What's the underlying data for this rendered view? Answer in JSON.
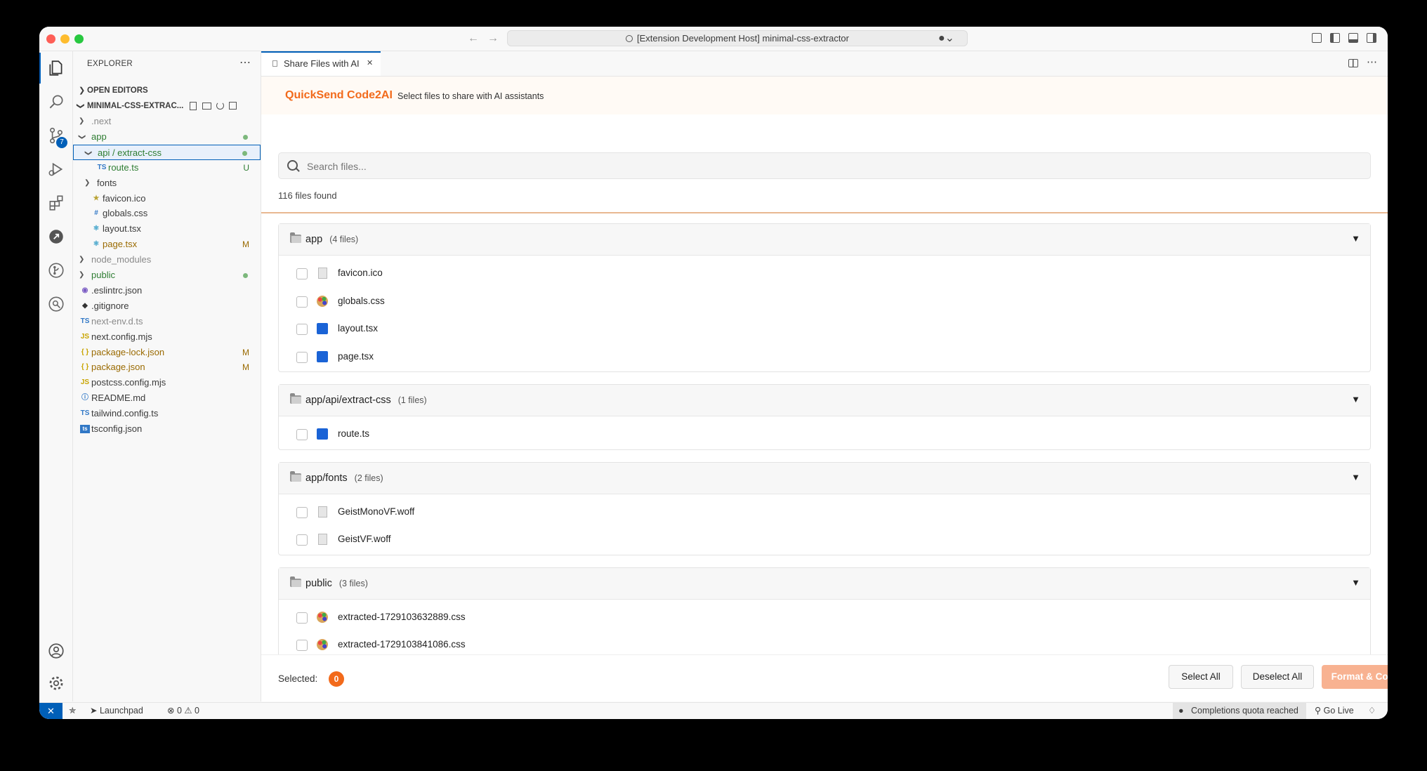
{
  "titlebar": {
    "command_center": "[Extension Development Host] minimal-css-extractor"
  },
  "activity": {
    "scm_badge": "7"
  },
  "sidebar": {
    "title": "EXPLORER",
    "more": "⋯",
    "open_editors": "OPEN EDITORS",
    "project": "MINIMAL-CSS-EXTRAC...",
    "tree": [
      {
        "name": ".next",
        "kind": "folder",
        "depth": 1,
        "state": "collapsed",
        "color": "#8a8a8a",
        "status": ""
      },
      {
        "name": "app",
        "kind": "folder",
        "depth": 1,
        "state": "expanded",
        "color": "#2e7d32",
        "status": "dot"
      },
      {
        "name": "api / extract-css",
        "kind": "folder",
        "depth": 2,
        "state": "expanded",
        "color": "#2e7d32",
        "status": "dot",
        "selected": true
      },
      {
        "name": "route.ts",
        "kind": "ts",
        "depth": 3,
        "color": "#2e7d32",
        "status": "U"
      },
      {
        "name": "fonts",
        "kind": "folder",
        "depth": 2,
        "state": "collapsed",
        "color": "#3b3b3b",
        "status": ""
      },
      {
        "name": "favicon.ico",
        "kind": "star",
        "depth": 2,
        "color": "#3b3b3b",
        "status": ""
      },
      {
        "name": "globals.css",
        "kind": "hash",
        "depth": 2,
        "color": "#3b3b3b",
        "status": ""
      },
      {
        "name": "layout.tsx",
        "kind": "react",
        "depth": 2,
        "color": "#3b3b3b",
        "status": ""
      },
      {
        "name": "page.tsx",
        "kind": "react",
        "depth": 2,
        "color": "#9a6a00",
        "status": "M"
      },
      {
        "name": "node_modules",
        "kind": "folder",
        "depth": 1,
        "state": "collapsed",
        "color": "#8a8a8a",
        "status": ""
      },
      {
        "name": "public",
        "kind": "folder",
        "depth": 1,
        "state": "collapsed",
        "color": "#2e7d32",
        "status": "dot"
      },
      {
        "name": ".eslintrc.json",
        "kind": "eslint",
        "depth": 1,
        "color": "#3b3b3b",
        "status": ""
      },
      {
        "name": ".gitignore",
        "kind": "git",
        "depth": 1,
        "color": "#3b3b3b",
        "status": ""
      },
      {
        "name": "next-env.d.ts",
        "kind": "ts",
        "depth": 1,
        "color": "#8a8a8a",
        "status": ""
      },
      {
        "name": "next.config.mjs",
        "kind": "js",
        "depth": 1,
        "color": "#3b3b3b",
        "status": ""
      },
      {
        "name": "package-lock.json",
        "kind": "json",
        "depth": 1,
        "color": "#9a6a00",
        "status": "M"
      },
      {
        "name": "package.json",
        "kind": "json",
        "depth": 1,
        "color": "#9a6a00",
        "status": "M"
      },
      {
        "name": "postcss.config.mjs",
        "kind": "js",
        "depth": 1,
        "color": "#3b3b3b",
        "status": ""
      },
      {
        "name": "README.md",
        "kind": "info",
        "depth": 1,
        "color": "#3b3b3b",
        "status": ""
      },
      {
        "name": "tailwind.config.ts",
        "kind": "ts",
        "depth": 1,
        "color": "#3b3b3b",
        "status": ""
      },
      {
        "name": "tsconfig.json",
        "kind": "tsconfig",
        "depth": 1,
        "color": "#3b3b3b",
        "status": ""
      }
    ]
  },
  "tab": {
    "label": "Share Files with AI",
    "close": "✕"
  },
  "extension": {
    "brand": "QuickSend Code2AI",
    "subtitle": "Select files to share with AI assistants",
    "search_placeholder": "Search files...",
    "files_found": "116 files found",
    "groups": [
      {
        "name": "app",
        "count": "(4 files)",
        "files": [
          {
            "name": "favicon.ico",
            "icon": "doc"
          },
          {
            "name": "globals.css",
            "icon": "palette"
          },
          {
            "name": "layout.tsx",
            "icon": "blue"
          },
          {
            "name": "page.tsx",
            "icon": "blue"
          }
        ]
      },
      {
        "name": "app/api/extract-css",
        "count": "(1 files)",
        "files": [
          {
            "name": "route.ts",
            "icon": "blue"
          }
        ]
      },
      {
        "name": "app/fonts",
        "count": "(2 files)",
        "files": [
          {
            "name": "GeistMonoVF.woff",
            "icon": "doc"
          },
          {
            "name": "GeistVF.woff",
            "icon": "doc"
          }
        ]
      },
      {
        "name": "public",
        "count": "(3 files)",
        "files": [
          {
            "name": "extracted-1729103632889.css",
            "icon": "palette"
          },
          {
            "name": "extracted-1729103841086.css",
            "icon": "palette"
          }
        ]
      }
    ],
    "toggle_symbol": "▼",
    "selected_label": "Selected:",
    "selected_count": "0",
    "select_all": "Select All",
    "deselect_all": "Deselect All",
    "format_copy": "Format & Copy"
  },
  "status": {
    "remote": "✕",
    "launchpad": "Launchpad",
    "errors": "⊗ 0 ⚠ 0",
    "quota": "Completions quota reached",
    "go_live": "Go Live"
  },
  "colors": {
    "accent": "#f26a1b",
    "vscode_blue": "#005fb8"
  }
}
